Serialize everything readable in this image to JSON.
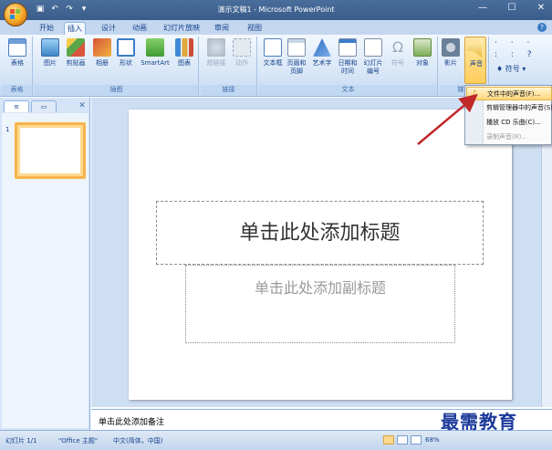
{
  "window": {
    "title": "演示文稿1 - Microsoft PowerPoint"
  },
  "tabs": [
    "开始",
    "插入",
    "设计",
    "动画",
    "幻灯片放映",
    "审阅",
    "视图"
  ],
  "active_tab": "插入",
  "ribbon": {
    "groups": {
      "tables": {
        "label": "表格",
        "buttons": [
          "表格"
        ]
      },
      "illustrations": {
        "label": "插图",
        "buttons": [
          "图片",
          "剪贴画",
          "相册",
          "形状",
          "SmartArt",
          "图表"
        ]
      },
      "links": {
        "label": "链接",
        "buttons": [
          "超链接",
          "动作"
        ]
      },
      "text": {
        "label": "文本",
        "buttons": [
          "文本框",
          "页眉和页脚",
          "艺术字",
          "日期和时间",
          "幻灯片编号",
          "符号",
          "对象"
        ]
      },
      "media": {
        "label": "媒体",
        "buttons": [
          "影片",
          "声音"
        ]
      },
      "special": {
        "symbol_label": "符号"
      }
    },
    "links_dim": true
  },
  "sound_menu": {
    "items": [
      {
        "label": "文件中的声音(F)...",
        "highlighted": true,
        "enabled": true
      },
      {
        "label": "剪辑管理器中的声音(S)...",
        "highlighted": false,
        "enabled": true
      },
      {
        "label": "播放 CD 乐曲(C)...",
        "highlighted": false,
        "enabled": true
      },
      {
        "label": "录制声音(R)...",
        "highlighted": false,
        "enabled": false
      }
    ]
  },
  "slides_pane": {
    "slide_number": "1"
  },
  "slide": {
    "title_placeholder": "单击此处添加标题",
    "subtitle_placeholder": "单击此处添加副标题"
  },
  "notes": {
    "placeholder": "单击此处添加备注"
  },
  "status_bar": {
    "slide_info": "幻灯片 1/1",
    "theme": "\"Office 主题\"",
    "language": "中文(简体，中国)",
    "zoom": "68%"
  },
  "watermark": "最需教育",
  "colors": {
    "accent_arrow": "#c0282a",
    "menu_highlight": "#ffd67e",
    "ribbon_bg": "#d5e4f6"
  }
}
